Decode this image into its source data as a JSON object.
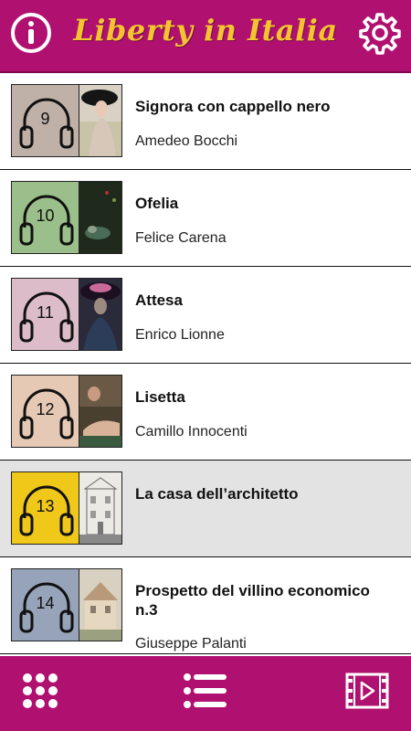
{
  "header": {
    "title": "Liberty in Italia",
    "info_icon": "info-icon",
    "settings_icon": "gear-icon"
  },
  "colors": {
    "brand": "#b0106f",
    "title": "#f4c430",
    "selected_row": "#e3e3e3"
  },
  "items": [
    {
      "number": "9",
      "title": "Signora con cappello nero",
      "artist": "Amedeo Bocchi",
      "tile_color": "#bfb0a8",
      "selected": false
    },
    {
      "number": "10",
      "title": "Ofelia",
      "artist": "Felice Carena",
      "tile_color": "#9bbf8a",
      "selected": false
    },
    {
      "number": "11",
      "title": "Attesa",
      "artist": "Enrico Lionne",
      "tile_color": "#dcbcc8",
      "selected": false
    },
    {
      "number": "12",
      "title": "Lisetta",
      "artist": "Camillo Innocenti",
      "tile_color": "#e6c9b4",
      "selected": false
    },
    {
      "number": "13",
      "title": "La casa dell’architetto",
      "artist": "",
      "tile_color": "#f0c81a",
      "selected": true
    },
    {
      "number": "14",
      "title": "Prospetto del villino economico n.3",
      "artist": "Giuseppe Palanti",
      "tile_color": "#97a3b8",
      "selected": false
    }
  ],
  "footer": {
    "grid_icon": "grid-icon",
    "list_icon": "list-icon",
    "video_icon": "video-icon"
  }
}
